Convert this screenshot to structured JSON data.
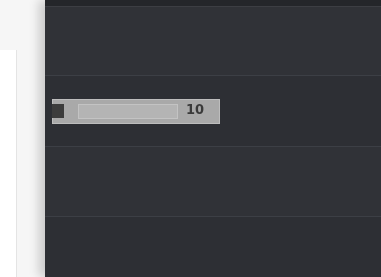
{
  "track": {
    "clip": {
      "value": "10"
    }
  },
  "colors": {
    "panel_background": "#2d2f34",
    "clip_fill": "#a9a9a9",
    "clip_text": "#3a3a3a"
  }
}
